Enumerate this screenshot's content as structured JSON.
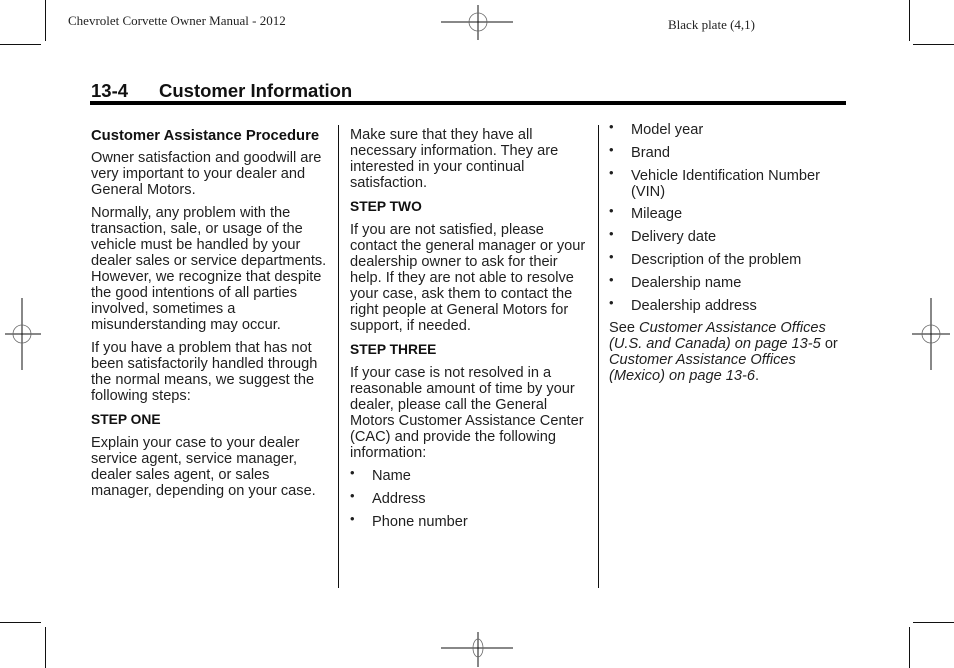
{
  "running_head": {
    "left": "Chevrolet Corvette Owner Manual - 2012",
    "right": "Black plate (4,1)"
  },
  "section": {
    "number": "13-4",
    "title": "Customer Information"
  },
  "column1": {
    "heading": "Customer Assistance Procedure",
    "paragraphs": [
      "Owner satisfaction and goodwill are very important to your dealer and General Motors.",
      "Normally, any problem with the transaction, sale, or usage of the vehicle must be handled by your dealer sales or service departments. However, we recognize that despite the good intentions of all parties involved, sometimes a misunderstanding may occur.",
      "If you have a problem that has not been satisfactorily handled through the normal means, we suggest the following steps:"
    ],
    "step_one": {
      "heading": "STEP ONE",
      "text": "Explain your case to your dealer service agent, service manager, dealer sales agent, or sales manager, depending on your case."
    }
  },
  "column2": {
    "continuation": "Make sure that they have all necessary information. They are interested in your continual satisfaction.",
    "step_two": {
      "heading": "STEP TWO",
      "text": "If you are not satisfied, please contact the general manager or your dealership owner to ask for their help. If they are not able to resolve your case, ask them to contact the right people at General Motors for support, if needed."
    },
    "step_three": {
      "heading": "STEP THREE",
      "text": "If your case is not resolved in a reasonable amount of time by your dealer, please call the General Motors Customer Assistance Center (CAC) and provide the following information:"
    },
    "bullets": [
      "Name",
      "Address",
      "Phone number"
    ]
  },
  "column3": {
    "bullets": [
      "Model year",
      "Brand",
      "Vehicle Identification Number (VIN)",
      "Mileage",
      "Delivery date",
      "Description of the problem",
      "Dealership name",
      "Dealership address"
    ],
    "see_also": {
      "prefix": "See ",
      "ref1": "Customer Assistance Offices (U.S. and Canada) on page 13-5",
      "middle": " or ",
      "ref2": "Customer Assistance Offices (Mexico) on page 13-6",
      "suffix": "."
    }
  },
  "bullet_glyph": "•"
}
